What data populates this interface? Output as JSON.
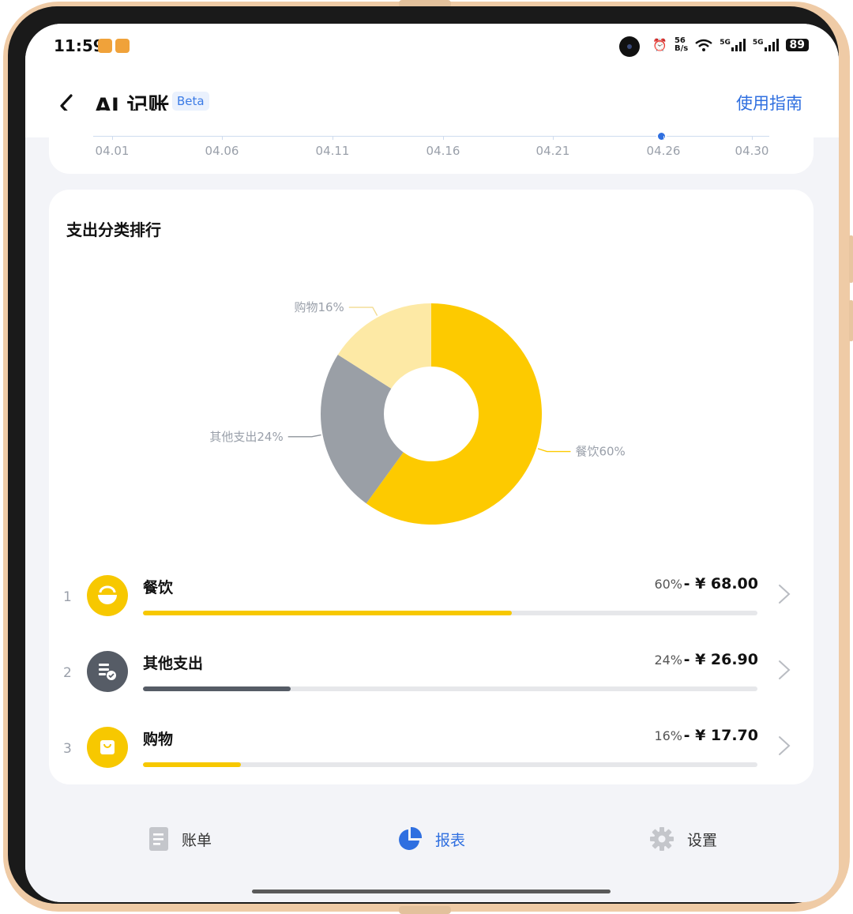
{
  "status_bar": {
    "time": "11:59",
    "speed_top": "56",
    "speed_bottom": "B/s",
    "net_1": "5G",
    "net_2": "5G",
    "battery": "89"
  },
  "header": {
    "title": "AI 记账",
    "badge": "Beta",
    "guide_link": "使用指南"
  },
  "trend_axis": {
    "labels": [
      "04.01",
      "04.06",
      "04.11",
      "04.16",
      "04.21",
      "04.26",
      "04.30"
    ]
  },
  "ranking": {
    "title": "支出分类排行",
    "chart_data": {
      "type": "pie",
      "donut": true,
      "slices": [
        {
          "name": "餐饮",
          "value": 60,
          "label": "餐饮60%",
          "color": "#fdca00"
        },
        {
          "name": "其他支出",
          "value": 24,
          "label": "其他支出24%",
          "color": "#9a9fa6"
        },
        {
          "name": "购物",
          "value": 16,
          "label": "购物16%",
          "color": "#fde9a5"
        }
      ]
    },
    "rows": [
      {
        "rank": "1",
        "name": "餐饮",
        "percent": "60%",
        "amount": "- ¥ 68.00",
        "fraction": 0.6,
        "color": "#f7c800",
        "icon": "bowl-icon"
      },
      {
        "rank": "2",
        "name": "其他支出",
        "percent": "24%",
        "amount": "- ¥ 26.90",
        "fraction": 0.24,
        "color": "#565c66",
        "icon": "receipt-icon"
      },
      {
        "rank": "3",
        "name": "购物",
        "percent": "16%",
        "amount": "- ¥ 17.70",
        "fraction": 0.16,
        "color": "#f7c800",
        "icon": "shopping-bag-icon"
      }
    ]
  },
  "tabs": [
    {
      "label": "账单",
      "icon": "bill-icon",
      "active": false
    },
    {
      "label": "报表",
      "icon": "pie-chart-icon",
      "active": true
    },
    {
      "label": "设置",
      "icon": "gear-icon",
      "active": false
    }
  ],
  "colors": {
    "accent": "#2f6fe0",
    "food": "#fdca00",
    "other": "#9a9fa6",
    "shopping": "#fde9a5"
  }
}
